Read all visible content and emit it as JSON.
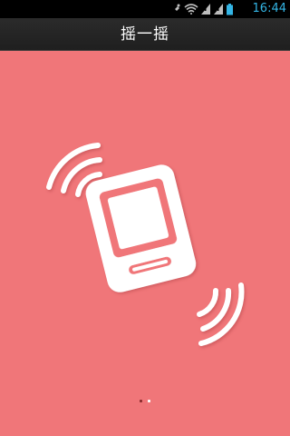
{
  "status_bar": {
    "time": "16:44",
    "icons": [
      "usb-debug-icon",
      "wifi-icon",
      "signal-icon",
      "signal-icon",
      "battery-icon"
    ],
    "accent_color": "#33b5e5"
  },
  "title_bar": {
    "title": "摇一摇"
  },
  "main": {
    "background_color": "#f07679",
    "illustration_icon": "shaking-phone-icon",
    "pager": {
      "total_pages": 2,
      "current_page": 1
    }
  }
}
